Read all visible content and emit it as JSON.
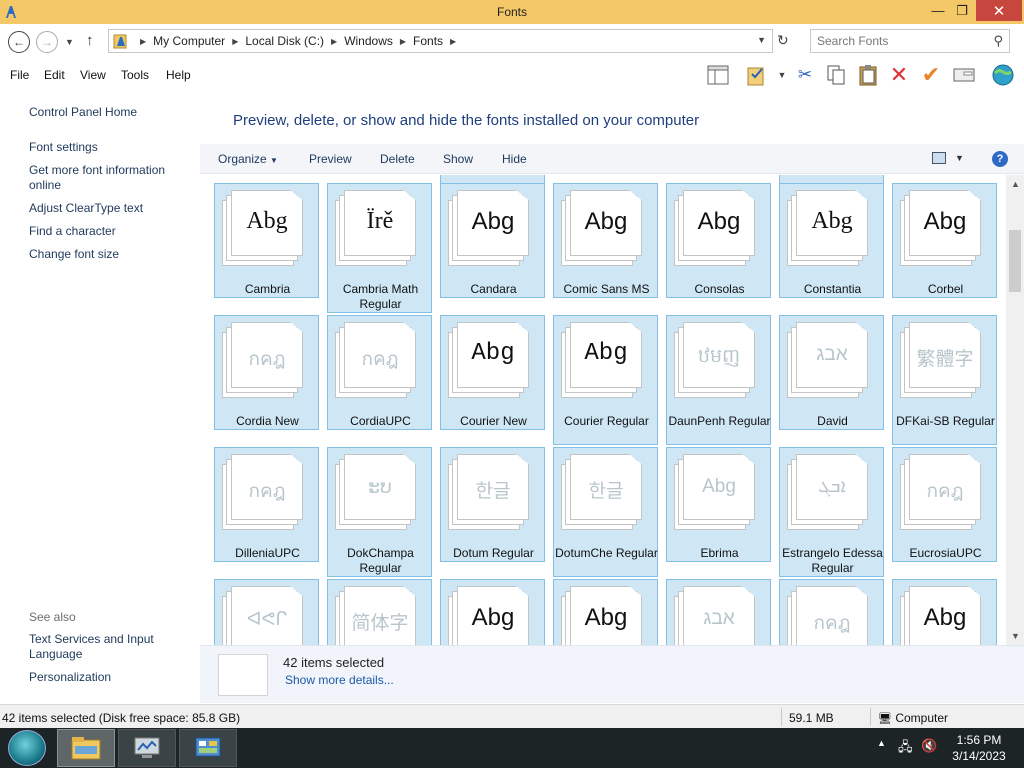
{
  "window": {
    "title": "Fonts",
    "min": "—",
    "max": "❐",
    "close": "✕"
  },
  "address": {
    "crumbs": [
      "My Computer",
      "Local Disk (C:)",
      "Windows",
      "Fonts"
    ],
    "search_placeholder": "Search Fonts"
  },
  "menu": [
    "File",
    "Edit",
    "View",
    "Tools",
    "Help"
  ],
  "left": {
    "links": [
      "Control Panel Home",
      "Font settings",
      "Get more font information online",
      "Adjust ClearType text",
      "Find a character",
      "Change font size"
    ],
    "see_also": "See also",
    "see_also_links": [
      "Text Services and Input Language",
      "Personalization"
    ]
  },
  "main": {
    "heading": "Preview, delete, or show and hide the fonts installed on your computer",
    "commands": [
      "Organize",
      "Preview",
      "Delete",
      "Show",
      "Hide"
    ],
    "help": "?",
    "fonts": [
      {
        "name": "Cambria",
        "sample": "Abg",
        "faded": false
      },
      {
        "name": "Cambria Math Regular",
        "sample": "Ïrě",
        "faded": false
      },
      {
        "name": "Candara",
        "sample": "Abg",
        "faded": false
      },
      {
        "name": "Comic Sans MS",
        "sample": "Abg",
        "faded": false
      },
      {
        "name": "Consolas",
        "sample": "Abg",
        "faded": false
      },
      {
        "name": "Constantia",
        "sample": "Abg",
        "faded": false
      },
      {
        "name": "Corbel",
        "sample": "Abg",
        "faded": false
      },
      {
        "name": "Cordia New",
        "sample": "กคฎ",
        "faded": true
      },
      {
        "name": "CordiaUPC",
        "sample": "กคฎ",
        "faded": true
      },
      {
        "name": "Courier New",
        "sample": "Abg",
        "faded": false
      },
      {
        "name": "Courier Regular",
        "sample": "Abg",
        "faded": false
      },
      {
        "name": "DaunPenh Regular",
        "sample": "ឋមញ",
        "faded": true
      },
      {
        "name": "David",
        "sample": "אבג",
        "faded": true
      },
      {
        "name": "DFKai-SB Regular",
        "sample": "繁體字",
        "faded": true
      },
      {
        "name": "DilleniaUPC",
        "sample": "กคฎ",
        "faded": true
      },
      {
        "name": "DokChampa Regular",
        "sample": "ະບ",
        "faded": true
      },
      {
        "name": "Dotum Regular",
        "sample": "한글",
        "faded": true
      },
      {
        "name": "DotumChe Regular",
        "sample": "한글",
        "faded": true
      },
      {
        "name": "Ebrima",
        "sample": "Abg",
        "faded": true
      },
      {
        "name": "Estrangelo Edessa Regular",
        "sample": "ܐܒܓ",
        "faded": true
      },
      {
        "name": "EucrosiaUPC",
        "sample": "กคฎ",
        "faded": true
      },
      {
        "name": "",
        "sample": "ᐊᕙᒋ",
        "faded": true
      },
      {
        "name": "",
        "sample": "简体字",
        "faded": true
      },
      {
        "name": "",
        "sample": "Abg",
        "faded": false
      },
      {
        "name": "",
        "sample": "Abg",
        "faded": false
      },
      {
        "name": "",
        "sample": "אבג",
        "faded": true
      },
      {
        "name": "",
        "sample": "กคฎ",
        "faded": true
      },
      {
        "name": "",
        "sample": "Abg",
        "faded": false
      }
    ]
  },
  "details": {
    "count": "42 items selected",
    "more": "Show more details..."
  },
  "status": {
    "selection": "42 items selected (Disk free space: 85.8 GB)",
    "size": "59.1 MB",
    "location": "Computer"
  },
  "taskbar": {
    "time": "1:56 PM",
    "date": "3/14/2023"
  },
  "colors": {
    "titlebar": "#f4c867",
    "close": "#c7473e",
    "tile": "#cfe7f5",
    "tile_border": "#84c0e5",
    "link": "#1e395b",
    "heading": "#1e3e7e"
  }
}
